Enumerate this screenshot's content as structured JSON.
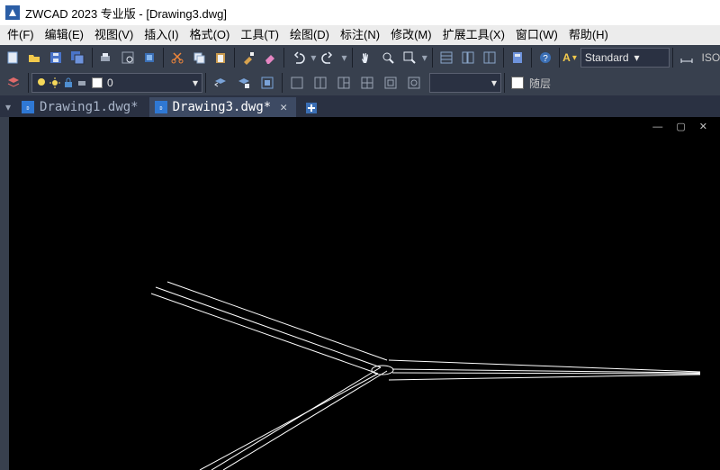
{
  "title": "ZWCAD 2023 专业版 - [Drawing3.dwg]",
  "menu": {
    "file": "件(F)",
    "edit": "编辑(E)",
    "view": "视图(V)",
    "insert": "插入(I)",
    "format": "格式(O)",
    "tools": "工具(T)",
    "draw": "绘图(D)",
    "dim": "标注(N)",
    "modify": "修改(M)",
    "ext": "扩展工具(X)",
    "window": "窗口(W)",
    "help": "帮助(H)"
  },
  "toolbar2": {
    "style_label": "A",
    "style_value": "Standard",
    "iso_label": "ISO"
  },
  "layerbar": {
    "layer_value": "0",
    "bylayer": "随层"
  },
  "tabs": {
    "t1": "Drawing1.dwg*",
    "t2": "Drawing3.dwg*"
  },
  "icons": {
    "dwg": "DWG"
  }
}
